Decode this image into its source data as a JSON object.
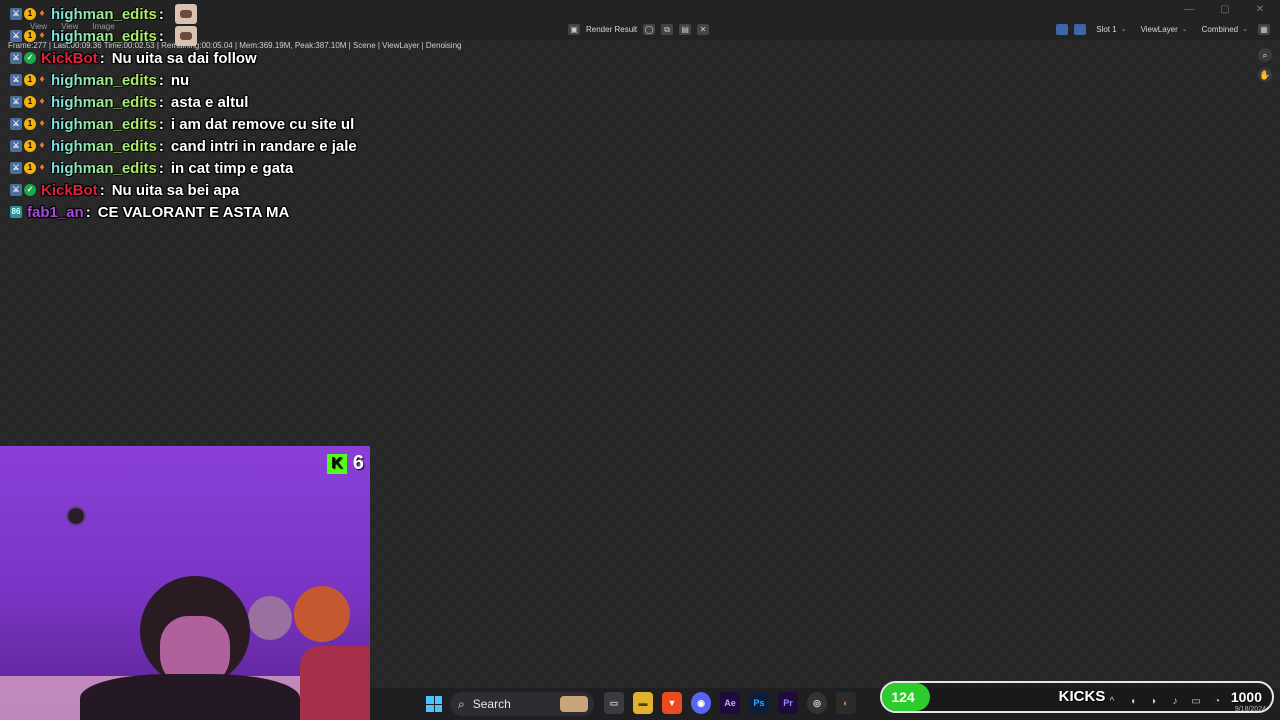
{
  "blender": {
    "menu": [
      "View",
      "View",
      "Image"
    ],
    "stats_line": "Frame:277 | Last:00:09.36 Time:00:02.53 | Remaining:00:05.04 | Mem:369.19M, Peak:387.10M | Scene | ViewLayer | Denoising",
    "image_name": "Render Result",
    "slot": "Slot 1",
    "view_layer": "ViewLayer",
    "pass": "Combined"
  },
  "chat": [
    {
      "badges": [
        "sword",
        "gold",
        "flame"
      ],
      "user": "highman_edits",
      "user_style": "highman",
      "text": "",
      "emote": true
    },
    {
      "badges": [
        "sword",
        "gold",
        "flame"
      ],
      "user": "highman_edits",
      "user_style": "highman",
      "text": "",
      "emote": true
    },
    {
      "badges": [
        "sword",
        "verify"
      ],
      "user": "KickBot",
      "user_style": "kickbot",
      "text": "Nu uita sa dai follow",
      "emote": false
    },
    {
      "badges": [
        "sword",
        "gold",
        "flame"
      ],
      "user": "highman_edits",
      "user_style": "highman",
      "text": "nu",
      "emote": false
    },
    {
      "badges": [
        "sword",
        "gold",
        "flame"
      ],
      "user": "highman_edits",
      "user_style": "highman",
      "text": "asta e altul",
      "emote": false
    },
    {
      "badges": [
        "sword",
        "gold",
        "flame"
      ],
      "user": "highman_edits",
      "user_style": "highman",
      "text": "i am dat remove cu site ul",
      "emote": false
    },
    {
      "badges": [
        "sword",
        "gold",
        "flame"
      ],
      "user": "highman_edits",
      "user_style": "highman",
      "text": "cand intri in randare e jale",
      "emote": false
    },
    {
      "badges": [
        "sword",
        "gold",
        "flame"
      ],
      "user": "highman_edits",
      "user_style": "highman",
      "text": "in cat timp e gata",
      "emote": false
    },
    {
      "badges": [
        "sword",
        "verify"
      ],
      "user": "KickBot",
      "user_style": "kickbot",
      "text": "Nu uita sa bei apa",
      "emote": false
    },
    {
      "badges": [
        "tag"
      ],
      "user": "fab1_an",
      "user_style": "fabian",
      "text": "CE VALORANT E ASTA MA",
      "emote": false
    }
  ],
  "webcam": {
    "kick_logo": "K",
    "viewer_count": "6"
  },
  "taskbar": {
    "search_label": "Search",
    "apps": [
      {
        "name": "files",
        "glyph": "▭"
      },
      {
        "name": "folder",
        "glyph": "▬"
      },
      {
        "name": "brave",
        "glyph": "▼"
      },
      {
        "name": "discord",
        "glyph": "◉"
      },
      {
        "name": "ae",
        "glyph": "Ae"
      },
      {
        "name": "ps",
        "glyph": "Ps"
      },
      {
        "name": "pr",
        "glyph": "Pr"
      },
      {
        "name": "obs",
        "glyph": "◎"
      },
      {
        "name": "blender",
        "glyph": "◐"
      }
    ],
    "date": "9/18/2024"
  },
  "kicks_goal": {
    "current": "124",
    "label": "KICKS",
    "goal": "1000",
    "progress": 0.124
  },
  "colors": {
    "accent_kick": "#53fc18",
    "progress_fill": "#2ccc2c",
    "kickbot": "#e0233a",
    "fabian": "#a64bd6"
  }
}
